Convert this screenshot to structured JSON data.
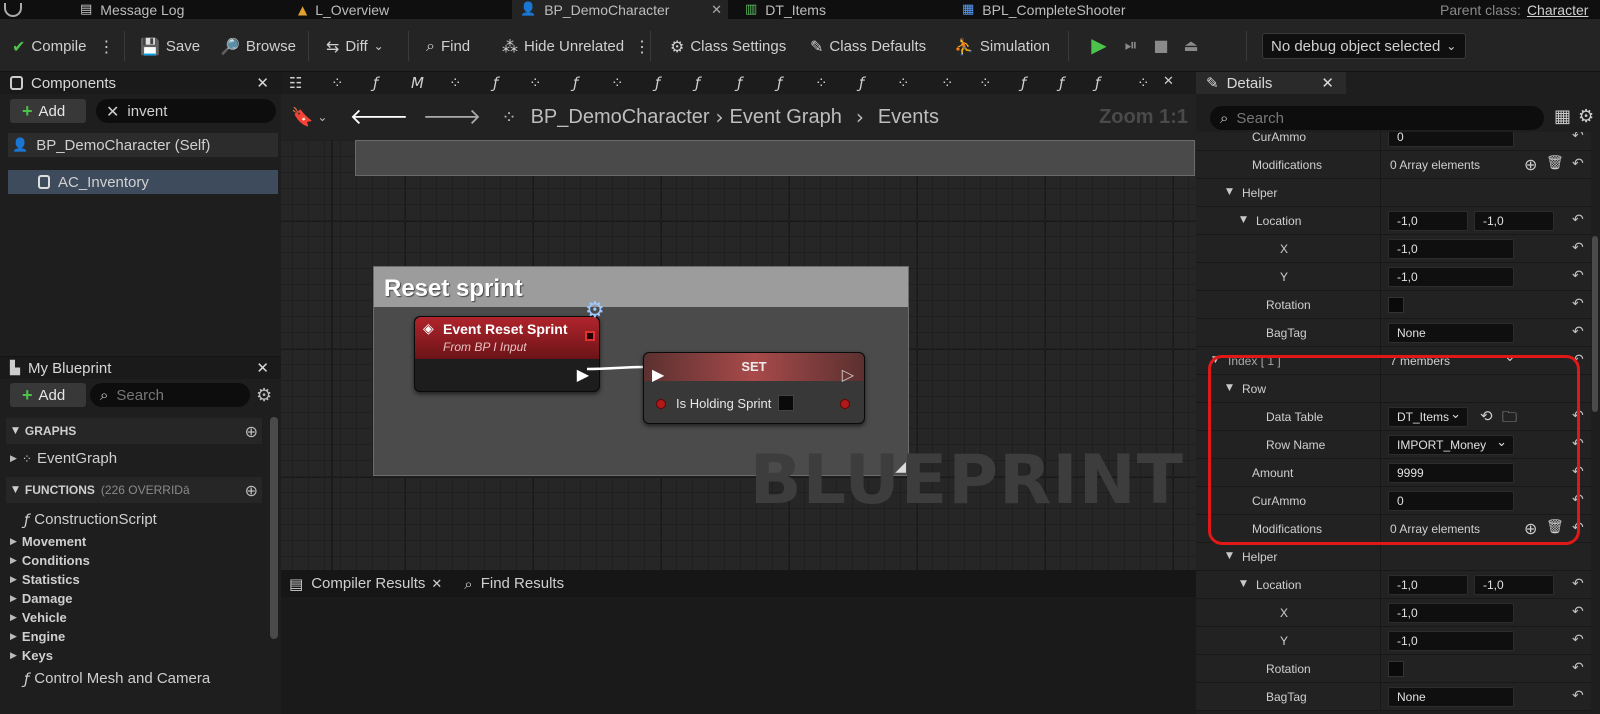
{
  "tabs": [
    {
      "label": "Message Log",
      "icon": "log-icon"
    },
    {
      "label": "L_Overview",
      "icon": "level-icon"
    },
    {
      "label": "BP_DemoCharacter",
      "icon": "character-blueprint-icon"
    },
    {
      "label": "DT_Items",
      "icon": "data-table-icon"
    },
    {
      "label": "BPL_CompleteShooter",
      "icon": "function-library-icon"
    }
  ],
  "tab_close": "✕",
  "parent_class_label": "Parent class:",
  "parent_class_value": "Character",
  "toolbar": {
    "compile": "Compile",
    "save": "Save",
    "browse": "Browse",
    "diff": "Diff",
    "find": "Find",
    "hide_unrelated": "Hide Unrelated",
    "class_settings": "Class Settings",
    "class_defaults": "Class Defaults",
    "simulation": "Simulation",
    "debug_object": "No debug object selected"
  },
  "components": {
    "title": "Components",
    "add": "Add",
    "search_value": "invent",
    "items": [
      "BP_DemoCharacter (Self)",
      "AC_Inventory"
    ]
  },
  "my_blueprint": {
    "title": "My Blueprint",
    "add": "Add",
    "search_placeholder": "Search",
    "graphs_label": "GRAPHS",
    "graph_items": [
      "EventGraph"
    ],
    "functions_label": "FUNCTIONS",
    "functions_sub": "(226 OVERRIDā",
    "construction_script": "ConstructionScript",
    "categories": [
      "Movement",
      "Conditions",
      "Statistics",
      "Damage",
      "Vehicle",
      "Engine",
      "Keys"
    ],
    "last_item": "Control Mesh and Camera"
  },
  "graph": {
    "breadcrumb": [
      "BP_DemoCharacter",
      "Event Graph",
      "Events"
    ],
    "zoom": "Zoom 1:1",
    "comment_title": "Reset sprint",
    "event_node_title": "Event Reset Sprint",
    "event_node_subtitle": "From BP I Input",
    "set_node_title": "SET",
    "set_pin_label": "Is Holding Sprint",
    "watermark": "BLUEPRINT"
  },
  "results": {
    "tabs": [
      "Compiler Results",
      "Find Results"
    ]
  },
  "details": {
    "title": "Details",
    "search_placeholder": "Search",
    "rows": [
      {
        "label": "CurAmmo",
        "indent": 1,
        "value": "0",
        "type": "input"
      },
      {
        "label": "Modifications",
        "indent": 1,
        "value": "0 Array elements",
        "type": "array"
      },
      {
        "label": "Helper",
        "indent": 1,
        "type": "group"
      },
      {
        "label": "Location",
        "indent": 2,
        "type": "vec2",
        "v1": "-1,0",
        "v2": "-1,0"
      },
      {
        "label": "X",
        "indent": 3,
        "value": "-1,0",
        "type": "input"
      },
      {
        "label": "Y",
        "indent": 3,
        "value": "-1,0",
        "type": "input"
      },
      {
        "label": "Rotation",
        "indent": 2,
        "type": "check"
      },
      {
        "label": "BagTag",
        "indent": 2,
        "value": "None",
        "type": "input"
      },
      {
        "label": "Index [ 1 ]",
        "indent": 0,
        "value": "7 members",
        "type": "index"
      },
      {
        "label": "Row",
        "indent": 1,
        "type": "group"
      },
      {
        "label": "Data Table",
        "indent": 2,
        "value": "DT_Items",
        "type": "asset"
      },
      {
        "label": "Row Name",
        "indent": 2,
        "value": "IMPORT_Money",
        "type": "combo"
      },
      {
        "label": "Amount",
        "indent": 1,
        "value": "9999",
        "type": "input"
      },
      {
        "label": "CurAmmo",
        "indent": 1,
        "value": "0",
        "type": "input"
      },
      {
        "label": "Modifications",
        "indent": 1,
        "value": "0 Array elements",
        "type": "array"
      },
      {
        "label": "Helper",
        "indent": 1,
        "type": "group"
      },
      {
        "label": "Location",
        "indent": 2,
        "type": "vec2",
        "v1": "-1,0",
        "v2": "-1,0"
      },
      {
        "label": "X",
        "indent": 3,
        "value": "-1,0",
        "type": "input"
      },
      {
        "label": "Y",
        "indent": 3,
        "value": "-1,0",
        "type": "input"
      },
      {
        "label": "Rotation",
        "indent": 2,
        "type": "check"
      },
      {
        "label": "BagTag",
        "indent": 2,
        "value": "None",
        "type": "input"
      }
    ]
  },
  "colors": {
    "accent_green": "#4cc44c",
    "event_red": "#b1242c",
    "highlight_red": "#e01818",
    "selection_blue": "#3d4b5c"
  }
}
